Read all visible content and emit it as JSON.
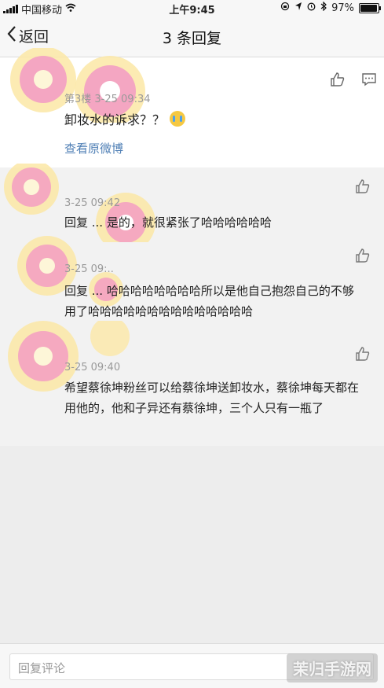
{
  "status_bar": {
    "carrier": "中国移动",
    "time": "上午9:45",
    "battery": "97%",
    "battery_level": 0.97
  },
  "nav": {
    "back_label": "返回",
    "title": "3 条回复"
  },
  "main_comment": {
    "floor_meta": "第3楼 3-25 09:34",
    "text": "卸妆水的诉求？？",
    "view_original": "查看原微博"
  },
  "replies": [
    {
      "meta": "3-25 09:42",
      "text": "回复 ... 是的，就很紧张了哈哈哈哈哈哈"
    },
    {
      "meta": "3-25 09:..",
      "text": "回复 ... 哈哈哈哈哈哈哈哈所以是他自己抱怨自己的不够用了哈哈哈哈哈哈哈哈哈哈哈哈哈哈"
    },
    {
      "meta": "3-25 09:40",
      "text": "希望蔡徐坤粉丝可以给蔡徐坤送卸妆水，蔡徐坤每天都在用他的，他和子异还有蔡徐坤，三个人只有一瓶了"
    }
  ],
  "bottom": {
    "reply_placeholder": "回复评论"
  },
  "watermark": "茉归手游网",
  "icons": {
    "back": "chevron-left-icon",
    "like": "thumbs-up-icon",
    "comment": "comment-icon"
  }
}
